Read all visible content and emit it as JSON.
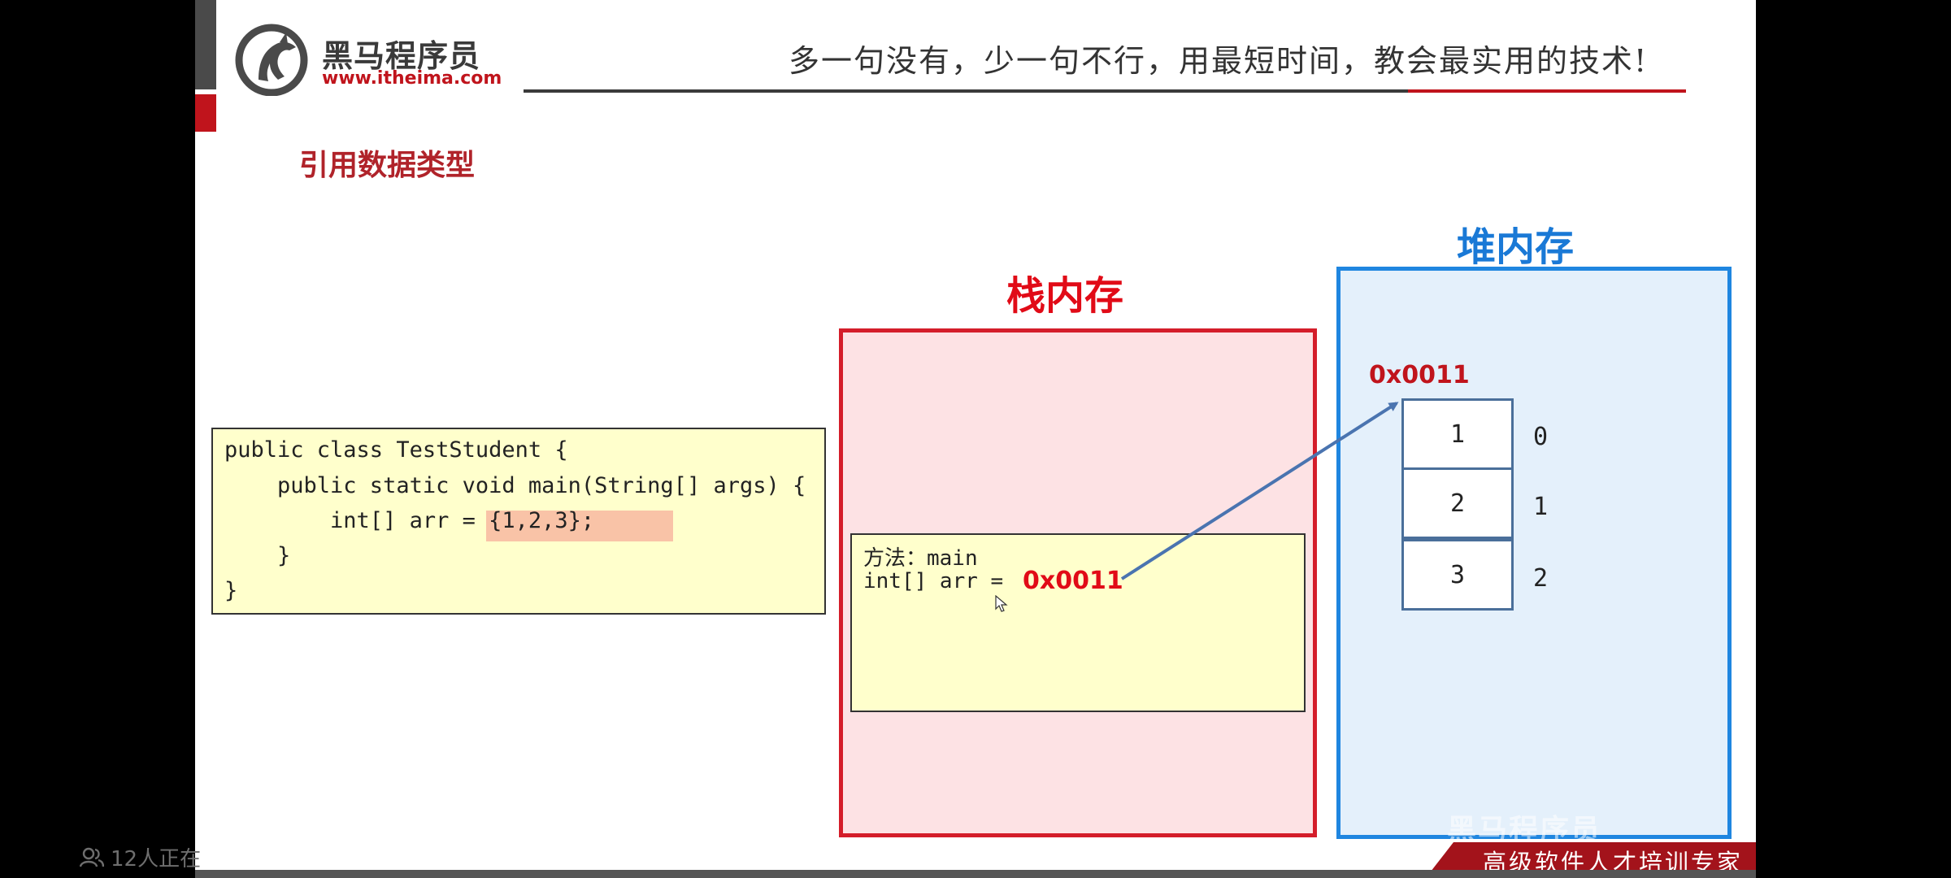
{
  "header": {
    "logo_cn": "黑马程序员",
    "logo_url": "www.itheima.com",
    "slogan": "多一句没有，少一句不行，用最短时间，教会最实用的技术!"
  },
  "section_title": "引用数据类型",
  "code": {
    "lines": [
      "public class TestStudent {",
      "    public static void main(String[] args) {",
      "        int[] arr = {1,2,3};",
      "    }",
      "}"
    ]
  },
  "stack": {
    "title": "栈内存",
    "frame_method": "方法：main",
    "frame_var": "int[] arr =",
    "frame_value": "0x0011"
  },
  "heap": {
    "title": "堆内存",
    "address": "0x0011",
    "cells": [
      "1",
      "2",
      "3"
    ],
    "indices": [
      "0",
      "1",
      "2"
    ]
  },
  "footer": {
    "watermark": "黑马程序员",
    "banner": "高级软件人才培训专家",
    "viewer_count": "12人正在"
  },
  "colors": {
    "brand_red": "#c0141c",
    "stack_red": "#e10b17",
    "heap_blue": "#1a79d6",
    "code_bg": "#ffffcc"
  }
}
